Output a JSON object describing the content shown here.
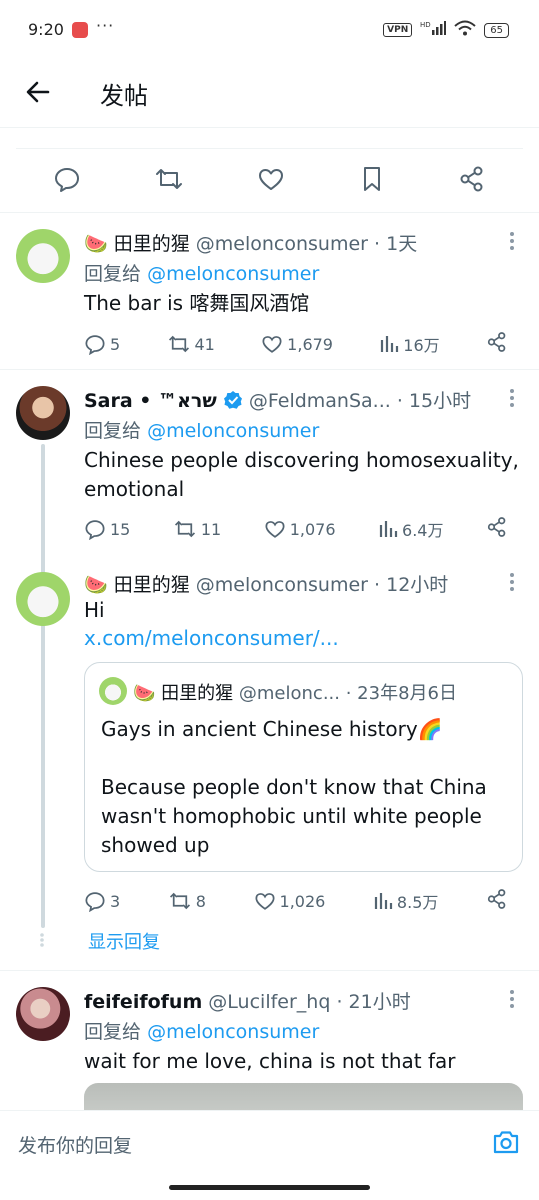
{
  "status_bar": {
    "time": "9:20",
    "dots": "···",
    "vpn": "VPN",
    "signal": "HD",
    "battery": "65"
  },
  "header": {
    "title": "发帖"
  },
  "colors": {
    "accent": "#1d9bf0",
    "muted": "#536471",
    "text": "#0f1419",
    "border": "#eff3f4"
  },
  "tweets": [
    {
      "emoji": "🍉",
      "display_name": "田里的猩",
      "handle": "@melonconsumer",
      "time": "· 1天",
      "reply_prefix": "回复给",
      "reply_handle": "@melonconsumer",
      "text": "The bar is 喀舞国风酒馆",
      "replies": "5",
      "retweets": "41",
      "likes": "1,679",
      "views": "16万"
    },
    {
      "display_name": "Sara • ™שרא",
      "handle": "@FeldmanSa...",
      "time": "· 15小时",
      "reply_prefix": "回复给",
      "reply_handle": "@melonconsumer",
      "text": "Chinese people discovering homosexuality, emotional",
      "replies": "15",
      "retweets": "11",
      "likes": "1,076",
      "views": "6.4万"
    },
    {
      "emoji": "🍉",
      "display_name": "田里的猩",
      "handle": "@melonconsumer",
      "time": "· 12小时",
      "text": "Hi",
      "link": "x.com/melonconsumer/...",
      "quote": {
        "emoji": "🍉",
        "display_name": "田里的猩",
        "handle": "@melonc...",
        "time": "· 23年8月6日",
        "line1": "Gays in ancient Chinese history🌈",
        "line2": "Because people don't know that China wasn't homophobic until white people showed up"
      },
      "replies": "3",
      "retweets": "8",
      "likes": "1,026",
      "views": "8.5万",
      "show_replies": "显示回复"
    },
    {
      "display_name": "feifeifofum",
      "handle": "@Lucilfer_hq",
      "time": "· 21小时",
      "reply_prefix": "回复给",
      "reply_handle": "@melonconsumer",
      "text": "wait for me love, china is not that far"
    }
  ],
  "composer": {
    "placeholder": "发布你的回复"
  }
}
